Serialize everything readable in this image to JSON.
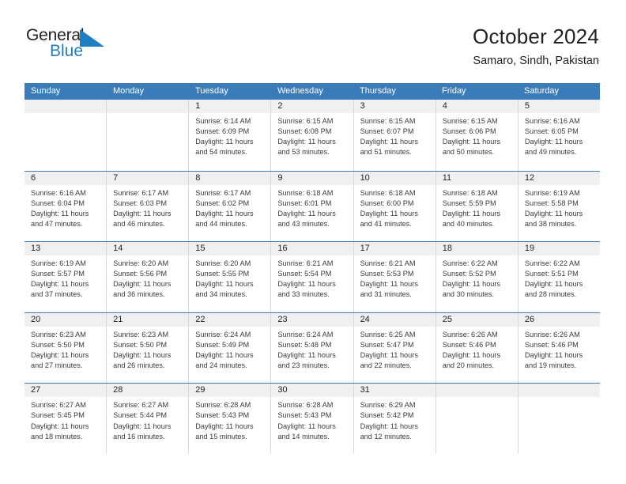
{
  "brand": {
    "name_part1": "General",
    "name_part2": "Blue",
    "triangle_color": "#1f7ec2",
    "blue_text_color": "#1f7ec2"
  },
  "header": {
    "month_title": "October 2024",
    "location": "Samaro, Sindh, Pakistan"
  },
  "theme": {
    "header_blue": "#3a7cba",
    "date_band": "#f0f0f0",
    "cell_border": "#d8d8d8",
    "text": "#231f20"
  },
  "weekdays": [
    "Sunday",
    "Monday",
    "Tuesday",
    "Wednesday",
    "Thursday",
    "Friday",
    "Saturday"
  ],
  "weeks": [
    [
      {
        "day": "",
        "sunrise": "",
        "sunset": "",
        "daylight": ""
      },
      {
        "day": "",
        "sunrise": "",
        "sunset": "",
        "daylight": ""
      },
      {
        "day": "1",
        "sunrise": "Sunrise: 6:14 AM",
        "sunset": "Sunset: 6:09 PM",
        "daylight": "Daylight: 11 hours and 54 minutes."
      },
      {
        "day": "2",
        "sunrise": "Sunrise: 6:15 AM",
        "sunset": "Sunset: 6:08 PM",
        "daylight": "Daylight: 11 hours and 53 minutes."
      },
      {
        "day": "3",
        "sunrise": "Sunrise: 6:15 AM",
        "sunset": "Sunset: 6:07 PM",
        "daylight": "Daylight: 11 hours and 51 minutes."
      },
      {
        "day": "4",
        "sunrise": "Sunrise: 6:15 AM",
        "sunset": "Sunset: 6:06 PM",
        "daylight": "Daylight: 11 hours and 50 minutes."
      },
      {
        "day": "5",
        "sunrise": "Sunrise: 6:16 AM",
        "sunset": "Sunset: 6:05 PM",
        "daylight": "Daylight: 11 hours and 49 minutes."
      }
    ],
    [
      {
        "day": "6",
        "sunrise": "Sunrise: 6:16 AM",
        "sunset": "Sunset: 6:04 PM",
        "daylight": "Daylight: 11 hours and 47 minutes."
      },
      {
        "day": "7",
        "sunrise": "Sunrise: 6:17 AM",
        "sunset": "Sunset: 6:03 PM",
        "daylight": "Daylight: 11 hours and 46 minutes."
      },
      {
        "day": "8",
        "sunrise": "Sunrise: 6:17 AM",
        "sunset": "Sunset: 6:02 PM",
        "daylight": "Daylight: 11 hours and 44 minutes."
      },
      {
        "day": "9",
        "sunrise": "Sunrise: 6:18 AM",
        "sunset": "Sunset: 6:01 PM",
        "daylight": "Daylight: 11 hours and 43 minutes."
      },
      {
        "day": "10",
        "sunrise": "Sunrise: 6:18 AM",
        "sunset": "Sunset: 6:00 PM",
        "daylight": "Daylight: 11 hours and 41 minutes."
      },
      {
        "day": "11",
        "sunrise": "Sunrise: 6:18 AM",
        "sunset": "Sunset: 5:59 PM",
        "daylight": "Daylight: 11 hours and 40 minutes."
      },
      {
        "day": "12",
        "sunrise": "Sunrise: 6:19 AM",
        "sunset": "Sunset: 5:58 PM",
        "daylight": "Daylight: 11 hours and 38 minutes."
      }
    ],
    [
      {
        "day": "13",
        "sunrise": "Sunrise: 6:19 AM",
        "sunset": "Sunset: 5:57 PM",
        "daylight": "Daylight: 11 hours and 37 minutes."
      },
      {
        "day": "14",
        "sunrise": "Sunrise: 6:20 AM",
        "sunset": "Sunset: 5:56 PM",
        "daylight": "Daylight: 11 hours and 36 minutes."
      },
      {
        "day": "15",
        "sunrise": "Sunrise: 6:20 AM",
        "sunset": "Sunset: 5:55 PM",
        "daylight": "Daylight: 11 hours and 34 minutes."
      },
      {
        "day": "16",
        "sunrise": "Sunrise: 6:21 AM",
        "sunset": "Sunset: 5:54 PM",
        "daylight": "Daylight: 11 hours and 33 minutes."
      },
      {
        "day": "17",
        "sunrise": "Sunrise: 6:21 AM",
        "sunset": "Sunset: 5:53 PM",
        "daylight": "Daylight: 11 hours and 31 minutes."
      },
      {
        "day": "18",
        "sunrise": "Sunrise: 6:22 AM",
        "sunset": "Sunset: 5:52 PM",
        "daylight": "Daylight: 11 hours and 30 minutes."
      },
      {
        "day": "19",
        "sunrise": "Sunrise: 6:22 AM",
        "sunset": "Sunset: 5:51 PM",
        "daylight": "Daylight: 11 hours and 28 minutes."
      }
    ],
    [
      {
        "day": "20",
        "sunrise": "Sunrise: 6:23 AM",
        "sunset": "Sunset: 5:50 PM",
        "daylight": "Daylight: 11 hours and 27 minutes."
      },
      {
        "day": "21",
        "sunrise": "Sunrise: 6:23 AM",
        "sunset": "Sunset: 5:50 PM",
        "daylight": "Daylight: 11 hours and 26 minutes."
      },
      {
        "day": "22",
        "sunrise": "Sunrise: 6:24 AM",
        "sunset": "Sunset: 5:49 PM",
        "daylight": "Daylight: 11 hours and 24 minutes."
      },
      {
        "day": "23",
        "sunrise": "Sunrise: 6:24 AM",
        "sunset": "Sunset: 5:48 PM",
        "daylight": "Daylight: 11 hours and 23 minutes."
      },
      {
        "day": "24",
        "sunrise": "Sunrise: 6:25 AM",
        "sunset": "Sunset: 5:47 PM",
        "daylight": "Daylight: 11 hours and 22 minutes."
      },
      {
        "day": "25",
        "sunrise": "Sunrise: 6:26 AM",
        "sunset": "Sunset: 5:46 PM",
        "daylight": "Daylight: 11 hours and 20 minutes."
      },
      {
        "day": "26",
        "sunrise": "Sunrise: 6:26 AM",
        "sunset": "Sunset: 5:46 PM",
        "daylight": "Daylight: 11 hours and 19 minutes."
      }
    ],
    [
      {
        "day": "27",
        "sunrise": "Sunrise: 6:27 AM",
        "sunset": "Sunset: 5:45 PM",
        "daylight": "Daylight: 11 hours and 18 minutes."
      },
      {
        "day": "28",
        "sunrise": "Sunrise: 6:27 AM",
        "sunset": "Sunset: 5:44 PM",
        "daylight": "Daylight: 11 hours and 16 minutes."
      },
      {
        "day": "29",
        "sunrise": "Sunrise: 6:28 AM",
        "sunset": "Sunset: 5:43 PM",
        "daylight": "Daylight: 11 hours and 15 minutes."
      },
      {
        "day": "30",
        "sunrise": "Sunrise: 6:28 AM",
        "sunset": "Sunset: 5:43 PM",
        "daylight": "Daylight: 11 hours and 14 minutes."
      },
      {
        "day": "31",
        "sunrise": "Sunrise: 6:29 AM",
        "sunset": "Sunset: 5:42 PM",
        "daylight": "Daylight: 11 hours and 12 minutes."
      },
      {
        "day": "",
        "sunrise": "",
        "sunset": "",
        "daylight": ""
      },
      {
        "day": "",
        "sunrise": "",
        "sunset": "",
        "daylight": ""
      }
    ]
  ]
}
